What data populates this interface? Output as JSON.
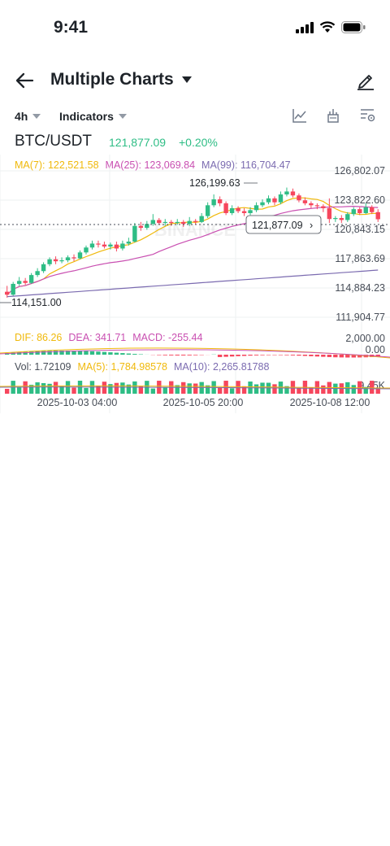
{
  "status_bar": {
    "time": "9:41"
  },
  "header": {
    "title": "Multiple Charts"
  },
  "toolbar": {
    "interval": "4h",
    "indicators": "Indicators"
  },
  "ticker": {
    "pair": "BTC/USDT",
    "price": "121,877.09",
    "change": "+0.20%"
  },
  "ma_legend": {
    "ma7": "MA(7): 122,521.58",
    "ma25": "MA(25): 123,069.84",
    "ma99": "MA(99): 116,704.47"
  },
  "macd_legend": {
    "dif": "DIF: 86.26",
    "dea": "DEA: 341.71",
    "macd": "MACD: -255.44"
  },
  "vol_legend": {
    "vol": "Vol: 1.72109",
    "ma5": "MA(5): 1,784.98578",
    "ma10": "MA(10): 2,265.81788"
  },
  "colors": {
    "up": "#2ebd85",
    "down": "#f6465d",
    "ma7": "#f0b90b",
    "ma25": "#c94fb1",
    "ma99": "#7b6bb0"
  },
  "watermark": "BINANCE",
  "chart_data": {
    "type": "candlestick",
    "y_ticks": [
      "126,802.07",
      "123,822.60",
      "120,843.15",
      "117,863.69",
      "114,884.23",
      "111,904.77"
    ],
    "x_ticks": [
      "2025-10-03 04:00",
      "2025-10-05 20:00",
      "2025-10-08 12:00"
    ],
    "ylim": [
      111904.77,
      126802.07
    ],
    "high_label": "126,199.63",
    "low_label": "114,151.00",
    "last_price_label": "121,877.09",
    "macd_y_ticks": [
      "2,000.00",
      "0.00"
    ],
    "volume_y_tick": "9.45K",
    "candles": [
      [
        114500,
        114200,
        115100,
        113900
      ],
      [
        114200,
        115300,
        115500,
        114100
      ],
      [
        115300,
        115600,
        116000,
        115100
      ],
      [
        115600,
        115400,
        115900,
        115200
      ],
      [
        115400,
        116200,
        116400,
        115300
      ],
      [
        116200,
        116600,
        116900,
        116000
      ],
      [
        116600,
        117300,
        117500,
        116400
      ],
      [
        117300,
        117800,
        118000,
        117100
      ],
      [
        117800,
        117600,
        118100,
        117300
      ],
      [
        117600,
        117700,
        118000,
        117400
      ],
      [
        117700,
        118000,
        118200,
        117500
      ],
      [
        118000,
        117900,
        118300,
        117600
      ],
      [
        117900,
        118500,
        118700,
        117800
      ],
      [
        118500,
        119000,
        119200,
        118300
      ],
      [
        119000,
        119400,
        119700,
        118800
      ],
      [
        119400,
        119300,
        119700,
        119000
      ],
      [
        119300,
        119100,
        119600,
        118900
      ],
      [
        119100,
        119300,
        119500,
        118800
      ],
      [
        119300,
        118900,
        119600,
        118600
      ],
      [
        118900,
        119400,
        119700,
        118700
      ],
      [
        119400,
        119600,
        120000,
        119200
      ],
      [
        119600,
        121200,
        121500,
        119500
      ],
      [
        121200,
        121000,
        121600,
        120700
      ],
      [
        121000,
        121400,
        121700,
        120800
      ],
      [
        121400,
        121800,
        122400,
        121200
      ],
      [
        121800,
        121500,
        122000,
        121300
      ],
      [
        121500,
        121600,
        121900,
        121200
      ],
      [
        121600,
        121500,
        121800,
        121200
      ],
      [
        121500,
        121600,
        121900,
        121300
      ],
      [
        121600,
        121400,
        121800,
        121100
      ],
      [
        121400,
        121700,
        122100,
        121200
      ],
      [
        121700,
        121600,
        121900,
        121300
      ],
      [
        121600,
        122200,
        122500,
        121500
      ],
      [
        122200,
        123300,
        123600,
        122000
      ],
      [
        123300,
        123900,
        124400,
        123100
      ],
      [
        123900,
        123500,
        124200,
        123200
      ],
      [
        123500,
        122500,
        123700,
        122300
      ],
      [
        122500,
        123000,
        123300,
        122300
      ],
      [
        123000,
        122700,
        123200,
        122500
      ],
      [
        122700,
        122500,
        123000,
        122200
      ],
      [
        122500,
        122800,
        123100,
        122300
      ],
      [
        122800,
        123300,
        123600,
        122600
      ],
      [
        123300,
        123600,
        123900,
        123100
      ],
      [
        123600,
        124000,
        124300,
        123400
      ],
      [
        124000,
        123600,
        124200,
        123300
      ],
      [
        123600,
        124400,
        124700,
        123400
      ],
      [
        124400,
        124700,
        125100,
        124200
      ],
      [
        124700,
        124300,
        125000,
        124100
      ],
      [
        124300,
        123800,
        124500,
        123600
      ],
      [
        123800,
        123500,
        124100,
        123300
      ],
      [
        123500,
        123300,
        123700,
        123000
      ],
      [
        123300,
        123200,
        123500,
        122900
      ],
      [
        123200,
        123000,
        123400,
        122600
      ],
      [
        123000,
        121900,
        124000,
        121500
      ],
      [
        121900,
        122000,
        122200,
        121600
      ],
      [
        122000,
        121800,
        122300,
        121500
      ],
      [
        121800,
        122400,
        122600,
        121600
      ],
      [
        122400,
        122900,
        123100,
        122200
      ],
      [
        122900,
        122500,
        123100,
        122300
      ],
      [
        122500,
        123100,
        123500,
        122400
      ],
      [
        123100,
        122600,
        123300,
        122400
      ],
      [
        122600,
        121877,
        122900,
        121600
      ]
    ]
  }
}
